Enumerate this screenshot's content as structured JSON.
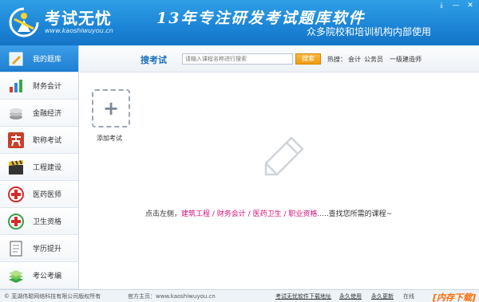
{
  "header": {
    "logo_title": "考试无忧",
    "logo_url": "www.kaoshiwuyou.cn",
    "slogan": "13年专注研发考试题库软件",
    "subslogan": "众多院校和培训机构内部使用",
    "controls": [
      "⤓",
      "—",
      "✕"
    ]
  },
  "sidebar": {
    "items": [
      {
        "label": "我的题库",
        "icon": "pen-icon",
        "active": true
      },
      {
        "label": "财务会计",
        "icon": "bar-chart-icon"
      },
      {
        "label": "金融经济",
        "icon": "coins-icon"
      },
      {
        "label": "职称考试",
        "icon": "kao-icon"
      },
      {
        "label": "工程建设",
        "icon": "clapper-icon"
      },
      {
        "label": "医药医师",
        "icon": "medical-cross-icon"
      },
      {
        "label": "卫生资格",
        "icon": "health-cross-icon"
      },
      {
        "label": "学历提升",
        "icon": "notepad-icon"
      },
      {
        "label": "考公考编",
        "icon": "books-icon"
      }
    ]
  },
  "search": {
    "label": "搜考试",
    "placeholder": "请输入课程名称进行搜索",
    "button": "搜索",
    "hot_label": "热搜：",
    "hot_links": [
      "会计",
      "公务员",
      "一级建造师"
    ]
  },
  "content": {
    "add_label": "添加考试",
    "hint_prefix": "点击左侧，",
    "hint_links": [
      "建筑工程",
      "财务会计",
      "医药卫生",
      "职业资格"
    ],
    "hint_sep": " / ",
    "hint_suffix": ".....查找您所需的课程~"
  },
  "footer": {
    "copyright": "© 芜湖伟聪网络科技有限公司版权所有",
    "site_label": "官方主页：www.kaoshiwuyou.cn",
    "links": [
      "考试无忧软件下载地址",
      "永久使用",
      "永久更新"
    ],
    "status": "在线",
    "watermark": "[内存下载]"
  },
  "colors": {
    "header_blue": "#1c84d6",
    "accent_pink": "#d4117a",
    "search_orange": "#ef9a0d"
  }
}
